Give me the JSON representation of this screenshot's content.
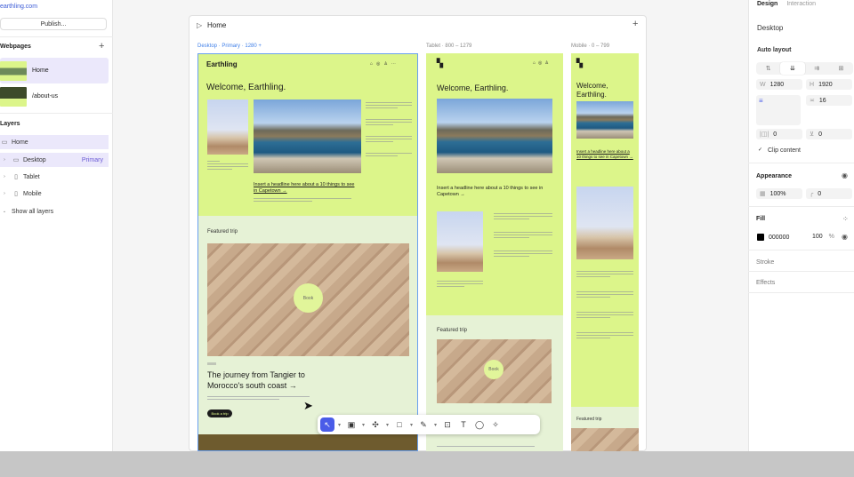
{
  "left": {
    "site_url": "earthling.com",
    "publish": "Publish...",
    "webpages_title": "Webpages",
    "pages": [
      {
        "label": "Home"
      },
      {
        "label": "/about-us"
      }
    ],
    "layers_title": "Layers",
    "layers": [
      {
        "label": "Home",
        "icon": "page-icon"
      },
      {
        "label": "Desktop",
        "tag": "Primary",
        "icon": "desktop-icon"
      },
      {
        "label": "Tablet",
        "icon": "tablet-icon"
      },
      {
        "label": "Mobile",
        "icon": "mobile-icon"
      }
    ],
    "show_all": "Show all layers"
  },
  "canvas": {
    "page_title": "Home",
    "breakpoints": {
      "desktop": {
        "name": "Desktop",
        "primary": "Primary",
        "range": "1280"
      },
      "tablet": {
        "name": "Tablet",
        "range": "800 – 1279"
      },
      "mobile": {
        "name": "Mobile",
        "range": "0 – 799"
      }
    },
    "site": {
      "logo": "Earthling",
      "welcome": "Welcome, Earthling.",
      "headline_link": "Insert a headline here about a 10 things to see in Capetown →",
      "featured": "Featured trip",
      "stamp": "Book",
      "trip_title": "The journey from Tangier to Morocco's south coast →",
      "cta": "Book a trip"
    }
  },
  "right": {
    "tab_design": "Design",
    "tab_interaction": "Interaction",
    "frame_name": "Desktop",
    "auto_layout": "Auto layout",
    "w_label": "W",
    "w_value": "1280",
    "h_label": "H",
    "h_value": "1920",
    "gap_value": "16",
    "pad_a": "0",
    "pad_b": "0",
    "clip": "Clip content",
    "appearance": "Appearance",
    "opacity": "100%",
    "radius": "0",
    "fill": "Fill",
    "fill_hex": "000000",
    "fill_opacity": "100",
    "fill_pct": "%",
    "stroke": "Stroke",
    "effects": "Effects"
  },
  "colors": {
    "accent": "#4a5ce8",
    "lime": "#dcf58a",
    "mint": "#e6f2d6",
    "selection": "#ebe8fb"
  }
}
